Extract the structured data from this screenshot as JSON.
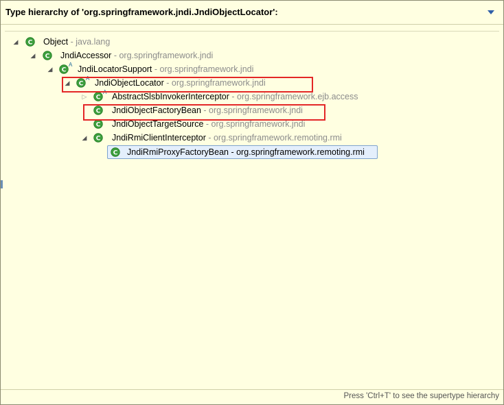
{
  "title": "Type hierarchy of 'org.springframework.jndi.JndiObjectLocator':",
  "status_hint": "Press 'Ctrl+T' to see the supertype hierarchy",
  "tree": [
    {
      "name": "Object",
      "pkg": "- java.lang"
    },
    {
      "name": "JndiAccessor",
      "pkg": "- org.springframework.jndi"
    },
    {
      "name": "JndiLocatorSupport",
      "pkg": "- org.springframework.jndi"
    },
    {
      "name": "JndiObjectLocator",
      "pkg": "- org.springframework.jndi"
    },
    {
      "name": "AbstractSlsbInvokerInterceptor",
      "pkg": "- org.springframework.ejb.access"
    },
    {
      "name": "JndiObjectFactoryBean",
      "pkg": "- org.springframework.jndi"
    },
    {
      "name": "JndiObjectTargetSource",
      "pkg": "- org.springframework.jndi"
    },
    {
      "name": "JndiRmiClientInterceptor",
      "pkg": "- org.springframework.remoting.rmi"
    },
    {
      "name": "JndiRmiProxyFactoryBean",
      "pkg": "- org.springframework.remoting.rmi"
    }
  ],
  "abstract_marker": "A",
  "icon_colors": {
    "class_fill": "#3e9f3e",
    "class_ring": "#1f7a1f"
  },
  "highlight_color": "#e32626"
}
